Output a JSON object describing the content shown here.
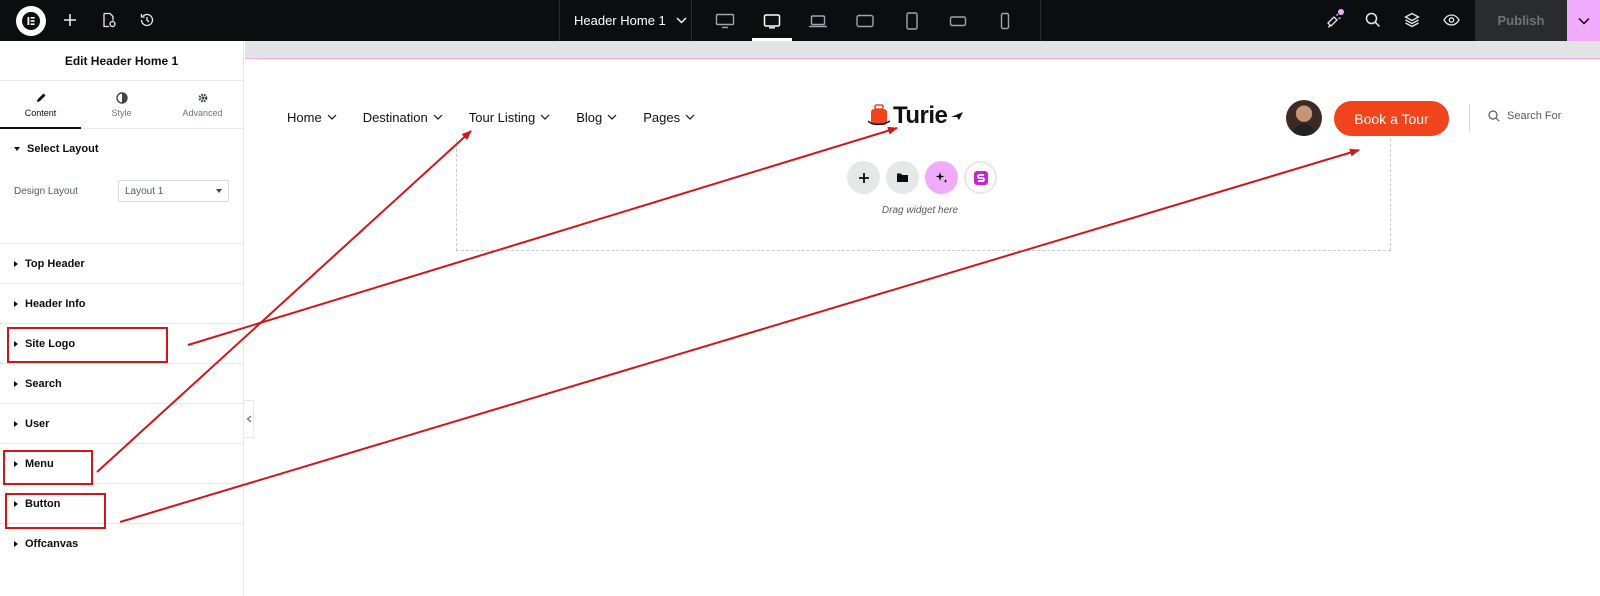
{
  "topbar": {
    "add_icon": "plus-icon",
    "page_icon": "page-settings-icon",
    "history_icon": "history-icon",
    "document_title": "Header Home 1",
    "devices": [
      "desktop",
      "tablet-landscape",
      "laptop",
      "widescreen",
      "tablet-portrait",
      "mobile-landscape",
      "mobile-portrait"
    ],
    "active_device": "tablet-landscape",
    "publish_label": "Publish",
    "accent_color": "#f0abfc"
  },
  "panel": {
    "title": "Edit Header Home 1",
    "tabs": [
      {
        "label": "Content",
        "icon": "pencil-icon"
      },
      {
        "label": "Style",
        "icon": "half-circle-icon"
      },
      {
        "label": "Advanced",
        "icon": "gear-icon"
      }
    ],
    "open_section": {
      "label": "Select Layout",
      "control_label": "Design Layout",
      "control_value": "Layout 1"
    },
    "sections": [
      "Top Header",
      "Header Info",
      "Site Logo",
      "Search",
      "User",
      "Menu",
      "Button",
      "Offcanvas"
    ]
  },
  "canvas": {
    "menu": [
      "Home",
      "Destination",
      "Tour Listing",
      "Blog",
      "Pages"
    ],
    "logo_text": "Turie",
    "book_button": "Book a Tour",
    "search_placeholder": "Search For",
    "drag_text": "Drag widget here",
    "brand_color": "#f2441c"
  },
  "annotation_color": "#d0161b"
}
